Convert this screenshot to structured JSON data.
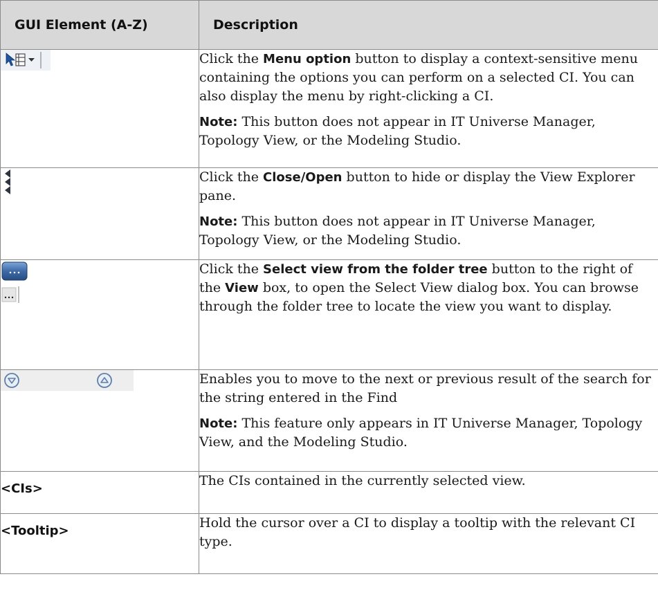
{
  "table": {
    "headers": {
      "element": "GUI Element (A-Z)",
      "description": "Description"
    },
    "rows": [
      {
        "element_icon": "menu-option-icon",
        "desc_a": "Click the ",
        "desc_bold": "Menu option",
        "desc_b": " button to display a context-sensitive menu containing the options you can perform on a selected CI. You can also display the menu by right-clicking a CI.",
        "note_label": "Note:",
        "note_text": " This button does not appear in IT Universe Manager, Topology View, or the Modeling Studio."
      },
      {
        "element_icon": "close-open-arrows-icon",
        "desc_a": "Click the ",
        "desc_bold": "Close/Open",
        "desc_b": " button to hide or display the View Explorer pane.",
        "note_label": "Note:",
        "note_text": " This button does not appear in IT Universe Manager, Topology View, or the Modeling Studio."
      },
      {
        "element_icon": "select-view-ellipsis-icon",
        "ellipsis": "...",
        "desc_a": "Click the ",
        "desc_bold": "Select view from the folder tree",
        "desc_b": " button to the right of the ",
        "desc_bold2": "View",
        "desc_c": " box, to open the Select View dialog box. You can browse through the folder tree to locate the view you want to display."
      },
      {
        "element_icon": "next-previous-result-icon",
        "desc": "Enables you to move to the next or previous result of the search for the string entered in the Find",
        "note_label": "Note:",
        "note_text": " This feature only appears in IT Universe Manager, Topology View, and the Modeling Studio."
      },
      {
        "element_text": "<CIs>",
        "desc": "The CIs contained in the currently selected view."
      },
      {
        "element_text": "<Tooltip>",
        "desc": "Hold the cursor over a CI to display a tooltip with the relevant CI type."
      }
    ]
  }
}
